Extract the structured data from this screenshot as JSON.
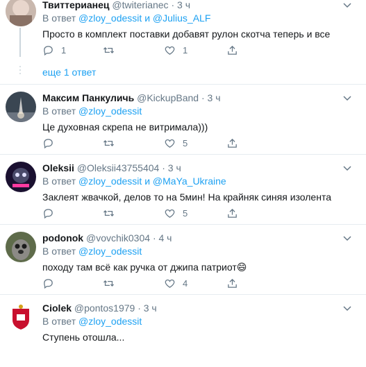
{
  "tweets": [
    {
      "name": "Твиттерианец",
      "handle": "@twiterianec",
      "dot": "·",
      "time": "3 ч",
      "reply_prefix": "В ответ",
      "reply_mention_1": "@zloy_odessit",
      "reply_and": "и",
      "reply_mention_2": "@Julius_ALF",
      "text": "Просто в комплект поставки добавят рулон скотча теперь и все",
      "reply_count": "1",
      "retweet_count": "",
      "like_count": "1"
    },
    {
      "name": "Максим Панкуличь",
      "handle": "@KickupBand",
      "dot": "·",
      "time": "3 ч",
      "reply_prefix": "В ответ",
      "reply_mention_1": "@zloy_odessit",
      "text": "Це духовная скрепа не витримала)))",
      "reply_count": "",
      "retweet_count": "",
      "like_count": "5"
    },
    {
      "name": "Oleksii",
      "handle": "@Oleksii43755404",
      "dot": "·",
      "time": "3 ч",
      "reply_prefix": "В ответ",
      "reply_mention_1": "@zloy_odessit",
      "reply_and": "и",
      "reply_mention_2": "@MaYa_Ukraine",
      "text": "Заклеят жвачкой, делов то на 5мин! На крайняк синяя изолента",
      "reply_count": "",
      "retweet_count": "",
      "like_count": "5"
    },
    {
      "name": "podonok",
      "handle": "@vovchik0304",
      "dot": "·",
      "time": "4 ч",
      "reply_prefix": "В ответ",
      "reply_mention_1": "@zloy_odessit",
      "text": "походу там всё как ручка от джипа патриот😄",
      "reply_count": "",
      "retweet_count": "",
      "like_count": "4"
    },
    {
      "name": "Ciolek",
      "handle": "@pontos1979",
      "dot": "·",
      "time": "3 ч",
      "reply_prefix": "В ответ",
      "reply_mention_1": "@zloy_odessit",
      "text": "Ступень отошла..."
    }
  ],
  "show_more_replies": "еще 1 ответ",
  "colors": {
    "accent": "#1da1f2",
    "secondary_text": "#657786",
    "divider": "#e6ecf0"
  },
  "icons": [
    "reply-icon",
    "retweet-icon",
    "like-icon",
    "share-icon",
    "caret-down-icon"
  ]
}
